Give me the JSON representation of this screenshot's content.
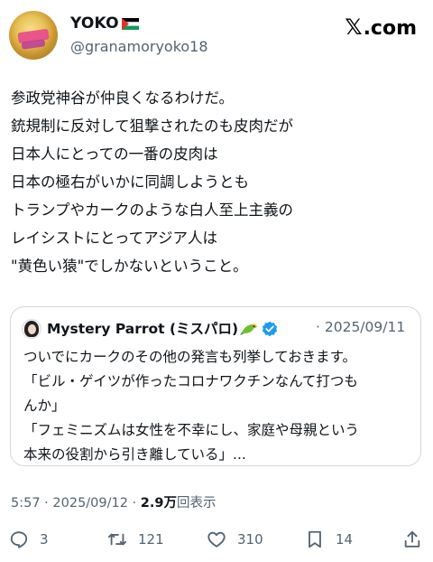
{
  "header": {
    "display_name": "YOKO",
    "handle": "@granamoryoko18",
    "site": ".com",
    "site_icon": "x-logo-icon",
    "flag": "palestine-flag-icon"
  },
  "tweet": {
    "lines": [
      "参政党神谷が仲良くなるわけだ。",
      "銃規制に反対して狙撃されたのも皮肉だが",
      "日本人にとっての一番の皮肉は",
      "日本の極右がいかに同調しようとも",
      "トランプやカークのような白人至上主義の",
      "レイシストにとってアジア人は",
      "\"黄色い猿\"でしかないということ。"
    ]
  },
  "quote": {
    "name": "Mystery Parrot (ミスパロ)",
    "date": "· 2025/09/11",
    "lines": [
      "ついでにカークのその他の発言も列挙しておきます。",
      "「ビル・ゲイツが作ったコロナワクチンなんて打つも",
      "んか」",
      "「フェミニズムは女性を不幸にし、家庭や母親という",
      "本来の役割から引き離している」..."
    ]
  },
  "meta": {
    "time": "5:57 · 2025/09/12 · ",
    "views": "2.9万",
    "views_label": "回表示"
  },
  "actions": {
    "replies": "3",
    "reposts": "121",
    "likes": "310",
    "bookmarks": "14"
  }
}
